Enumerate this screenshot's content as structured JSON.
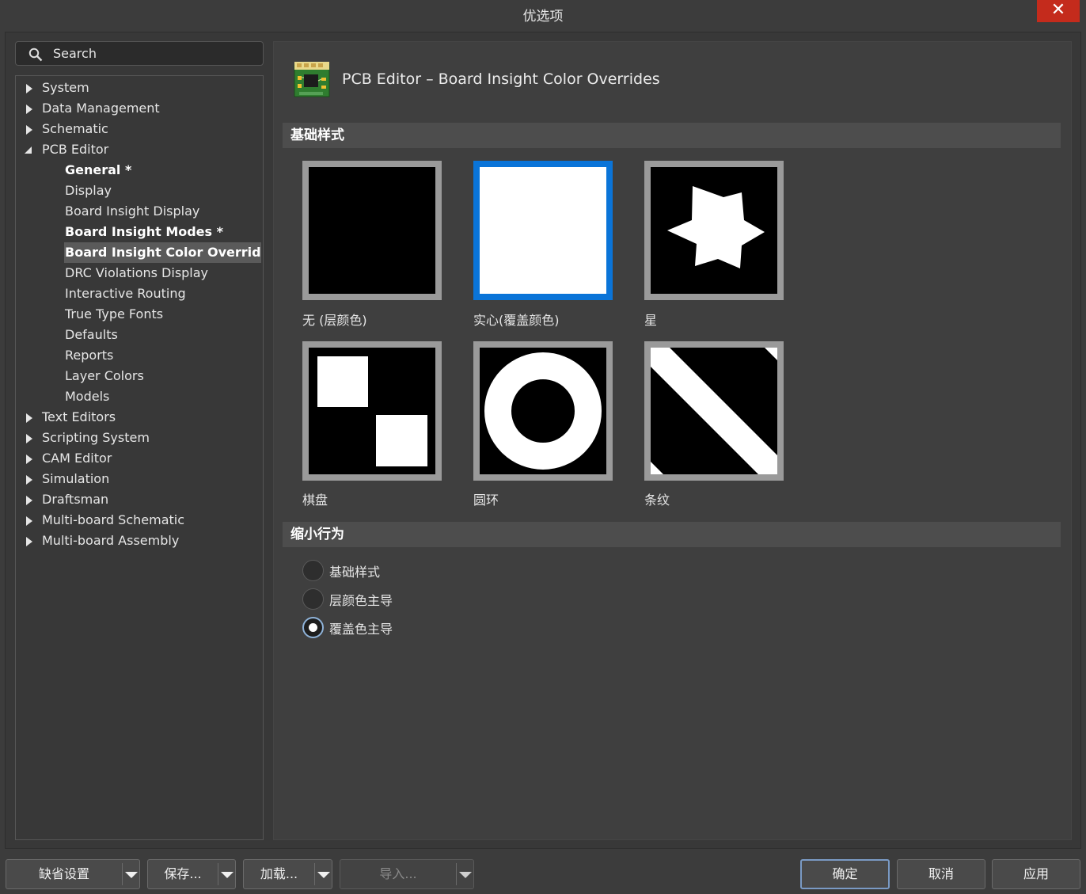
{
  "window": {
    "title": "优选项",
    "close_glyph": "✕"
  },
  "search": {
    "label": "Search"
  },
  "tree": {
    "top_items": [
      {
        "label": "System",
        "expanded": false
      },
      {
        "label": "Data Management",
        "expanded": false
      },
      {
        "label": "Schematic",
        "expanded": false
      },
      {
        "label": "PCB Editor",
        "expanded": true
      },
      {
        "label": "Text Editors",
        "expanded": false
      },
      {
        "label": "Scripting System",
        "expanded": false
      },
      {
        "label": "CAM Editor",
        "expanded": false
      },
      {
        "label": "Simulation",
        "expanded": false
      },
      {
        "label": "Draftsman",
        "expanded": false
      },
      {
        "label": "Multi-board Schematic",
        "expanded": false
      },
      {
        "label": "Multi-board Assembly",
        "expanded": false
      }
    ],
    "pcb_children": [
      {
        "label": "General *",
        "bold": true
      },
      {
        "label": "Display",
        "bold": false
      },
      {
        "label": "Board Insight Display",
        "bold": false
      },
      {
        "label": "Board Insight Modes *",
        "bold": true
      },
      {
        "label": "Board Insight Color Overrides *",
        "bold": true,
        "selected": true
      },
      {
        "label": "DRC Violations Display",
        "bold": false
      },
      {
        "label": "Interactive Routing",
        "bold": false
      },
      {
        "label": "True Type Fonts",
        "bold": false
      },
      {
        "label": "Defaults",
        "bold": false
      },
      {
        "label": "Reports",
        "bold": false
      },
      {
        "label": "Layer Colors",
        "bold": false
      },
      {
        "label": "Models",
        "bold": false
      }
    ]
  },
  "page": {
    "title": "PCB Editor – Board Insight Color Overrides",
    "icon": "pcb-board-icon"
  },
  "base_pattern": {
    "heading": "基础样式",
    "options": [
      {
        "label": "无 (层颜色)",
        "pattern": "none",
        "selected": false
      },
      {
        "label": "实心(覆盖颜色)",
        "pattern": "solid",
        "selected": true
      },
      {
        "label": "星",
        "pattern": "star",
        "selected": false
      },
      {
        "label": "棋盘",
        "pattern": "checkerboard",
        "selected": false
      },
      {
        "label": "圆环",
        "pattern": "circle",
        "selected": false
      },
      {
        "label": "条纹",
        "pattern": "stripe",
        "selected": false
      }
    ]
  },
  "zoom_out_behavior": {
    "heading": "缩小行为",
    "options": [
      {
        "label": "基础样式",
        "checked": false
      },
      {
        "label": "层颜色主导",
        "checked": false
      },
      {
        "label": "覆盖色主导",
        "checked": true
      }
    ]
  },
  "buttons": {
    "defaults": "缺省设置",
    "save": "保存...",
    "load": "加载...",
    "import": "导入...",
    "ok": "确定",
    "cancel": "取消",
    "apply": "应用"
  },
  "colors": {
    "selected_tile": "#0a74d8",
    "close_button": "#c42b1c"
  }
}
